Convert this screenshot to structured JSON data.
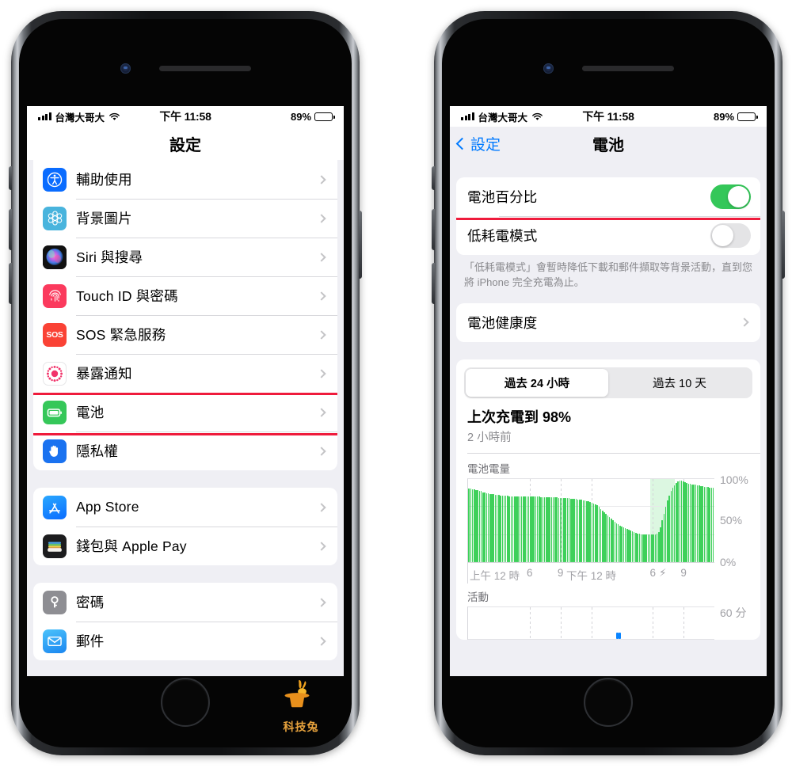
{
  "status_bar": {
    "carrier": "台灣大哥大",
    "time": "下午 11:58",
    "battery_percent": "89%",
    "signal_icon": "cellular-signal-icon",
    "wifi_icon": "wifi-icon",
    "battery_icon": "battery-icon"
  },
  "left_phone": {
    "nav": {
      "title": "設定"
    },
    "groups": [
      {
        "rows": [
          {
            "label": "輔助使用",
            "icon": "accessibility-icon",
            "color": "#0a6cff"
          },
          {
            "label": "背景圖片",
            "icon": "wallpaper-icon",
            "color": "#49b4dd"
          },
          {
            "label": "Siri 與搜尋",
            "icon": "siri-icon",
            "color": "#1c1c1e"
          },
          {
            "label": "Touch ID 與密碼",
            "icon": "touch-id-icon",
            "color": "#fb3a5d"
          },
          {
            "label": "SOS 緊急服務",
            "icon": "sos-icon",
            "color": "#fa4235"
          },
          {
            "label": "暴露通知",
            "icon": "exposure-notification-icon",
            "color": "#ffffff"
          },
          {
            "label": "電池",
            "icon": "battery-settings-icon",
            "color": "#35c759",
            "highlighted": true
          },
          {
            "label": "隱私權",
            "icon": "privacy-hand-icon",
            "color": "#1a72f0"
          }
        ]
      },
      {
        "rows": [
          {
            "label": "App Store",
            "icon": "app-store-icon",
            "color": "#1a8cff"
          },
          {
            "label": "錢包與 Apple Pay",
            "icon": "wallet-icon",
            "color": "#1c1c1e"
          }
        ]
      },
      {
        "rows": [
          {
            "label": "密碼",
            "icon": "passwords-key-icon",
            "color": "#8e8e93"
          },
          {
            "label": "郵件",
            "icon": "mail-icon",
            "color": "#2fa3f7"
          }
        ]
      }
    ],
    "watermark": {
      "text": "科技兔",
      "icon": "rabbit-in-hat-icon",
      "color": "#e8a33d"
    }
  },
  "right_phone": {
    "nav": {
      "back_label": "設定",
      "title": "電池",
      "back_icon": "chevron-left-icon"
    },
    "toggles": [
      {
        "label": "電池百分比",
        "state": "on",
        "highlighted": true
      },
      {
        "label": "低耗電模式",
        "state": "off",
        "highlighted": false
      }
    ],
    "footnote": "「低耗電模式」會暫時降低下載和郵件擷取等背景活動，直到您將 iPhone 完全充電為止。",
    "battery_health_row": {
      "label": "電池健康度",
      "chevron": "chevron-right-icon"
    },
    "segmented": {
      "options": [
        "過去 24 小時",
        "過去 10 天"
      ],
      "selected_index": 0
    },
    "last_charge": {
      "title": "上次充電到 98%",
      "subtitle": "2 小時前"
    },
    "colors": {
      "accent_blue": "#007aff",
      "green": "#34c759",
      "chart_green": "#3ed05a",
      "activity_blue": "#0a84ff",
      "highlight_red": "#ef1b3c"
    }
  },
  "chart_data": [
    {
      "type": "bar",
      "title": "電池電量",
      "xlabel": "",
      "ylabel": "",
      "ylim": [
        0,
        100
      ],
      "ytick_labels": [
        "100%",
        "50%",
        "0%"
      ],
      "ytick_values": [
        100,
        50,
        0
      ],
      "xtick_labels": [
        "上午 12 時",
        "6",
        "9",
        "下午 12 時",
        "6",
        "9"
      ],
      "xtick_positions": [
        0,
        25,
        37.5,
        50,
        75,
        87.5
      ],
      "grid": true,
      "annotations": [
        {
          "type": "charging-bolt-icon",
          "label": "⚡",
          "x_percent": 79
        }
      ],
      "charging_band": {
        "start_percent": 74,
        "end_percent": 84
      },
      "values": [
        88,
        88,
        87,
        87,
        86,
        86,
        85,
        85,
        84,
        84,
        83,
        83,
        82,
        82,
        82,
        81,
        81,
        81,
        80,
        80,
        80,
        80,
        80,
        79,
        79,
        79,
        79,
        79,
        79,
        79,
        79,
        79,
        79,
        79,
        79,
        79,
        79,
        79,
        79,
        79,
        79,
        78,
        78,
        78,
        78,
        78,
        78,
        78,
        78,
        78,
        78,
        77,
        77,
        77,
        77,
        77,
        77,
        77,
        76,
        76,
        76,
        76,
        75,
        75,
        75,
        74,
        74,
        73,
        73,
        72,
        71,
        70,
        69,
        68,
        66,
        64,
        62,
        60,
        58,
        56,
        54,
        52,
        50,
        48,
        46,
        45,
        44,
        43,
        42,
        41,
        40,
        39,
        38,
        37,
        36,
        35,
        34,
        34,
        33,
        33,
        33,
        33,
        33,
        33,
        33,
        33,
        33,
        34,
        36,
        42,
        50,
        58,
        66,
        74,
        80,
        85,
        89,
        92,
        95,
        97,
        98,
        98,
        97,
        96,
        95,
        94,
        94,
        93,
        93,
        93,
        92,
        92,
        91,
        91,
        90,
        90,
        90,
        89,
        89,
        89
      ]
    },
    {
      "type": "bar",
      "title": "活動",
      "ylim": [
        0,
        60
      ],
      "ytick_labels": [
        "60 分"
      ],
      "grid": true,
      "values": [
        0,
        0,
        0,
        0,
        0,
        0,
        0,
        0,
        0,
        0,
        0,
        0,
        0,
        0,
        0,
        0,
        0,
        0,
        0,
        0,
        0,
        0,
        0,
        0,
        0,
        0,
        0,
        0,
        0,
        0,
        0,
        0,
        0,
        0,
        0,
        0,
        0,
        0,
        0,
        0,
        0,
        0,
        0,
        0,
        0,
        0,
        0,
        0,
        0,
        0,
        0,
        0,
        0,
        0,
        0,
        0,
        0,
        0,
        0,
        0,
        12,
        12,
        0,
        0,
        0,
        0,
        0,
        0,
        0,
        0,
        0,
        0,
        0,
        0,
        0,
        0,
        0,
        0,
        0,
        0,
        0,
        0,
        0,
        0,
        0,
        0,
        0,
        0,
        0,
        0,
        0,
        0,
        0,
        0,
        0,
        0,
        0,
        0,
        0,
        0
      ]
    }
  ]
}
